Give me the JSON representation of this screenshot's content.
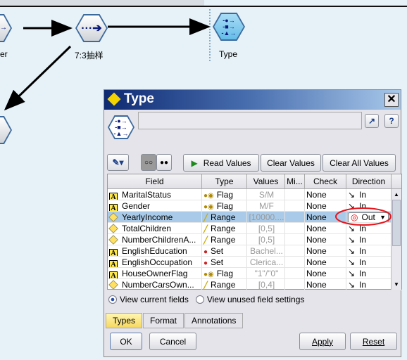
{
  "canvas": {
    "nodes": [
      {
        "label": "er",
        "icon": "filter-node-icon"
      },
      {
        "label": "7:3抽样",
        "icon": "sample-node-icon"
      },
      {
        "label": "Type",
        "icon": "type-node-icon"
      }
    ]
  },
  "dialog": {
    "title": "Type",
    "toolbar": {
      "read_values": "Read Values",
      "clear_values": "Clear Values",
      "clear_all_values": "Clear All Values"
    },
    "table": {
      "columns": [
        "Field",
        "Type",
        "Values",
        "Mi...",
        "Check",
        "Direction"
      ],
      "rows": [
        {
          "field": "MaritalStatus",
          "ficon": "A",
          "type": "Flag",
          "values": "S/M",
          "check": "None",
          "direction": "In"
        },
        {
          "field": "Gender",
          "ficon": "A",
          "type": "Flag",
          "values": "M/F",
          "check": "None",
          "direction": "In"
        },
        {
          "field": "YearlyIncome",
          "ficon": "#",
          "type": "Range",
          "values": "[10000....",
          "check": "None",
          "direction": "Out",
          "selected": true
        },
        {
          "field": "TotalChildren",
          "ficon": "D",
          "type": "Range",
          "values": "[0,5]",
          "check": "None",
          "direction": "In"
        },
        {
          "field": "NumberChildrenA...",
          "ficon": "D",
          "type": "Range",
          "values": "[0,5]",
          "check": "None",
          "direction": "In"
        },
        {
          "field": "EnglishEducation",
          "ficon": "A",
          "type": "Set",
          "values": "Bachel...",
          "check": "None",
          "direction": "In"
        },
        {
          "field": "EnglishOccupation",
          "ficon": "A",
          "type": "Set",
          "values": "Clerica...",
          "check": "None",
          "direction": "In"
        },
        {
          "field": "HouseOwnerFlag",
          "ficon": "A",
          "type": "Flag",
          "values": "\"1\"/\"0\"",
          "check": "None",
          "direction": "In"
        },
        {
          "field": "NumberCarsOwn...",
          "ficon": "D",
          "type": "Range",
          "values": "[0,4]",
          "check": "None",
          "direction": "In"
        }
      ]
    },
    "radios": {
      "current": "View current fields",
      "unused": "View unused field settings",
      "selected": "current"
    },
    "tabs": [
      "Types",
      "Format",
      "Annotations"
    ],
    "active_tab": "Types",
    "buttons": {
      "ok": "OK",
      "cancel": "Cancel",
      "apply": "Apply",
      "reset": "Reset"
    },
    "highlight_color": "#e8141c"
  }
}
